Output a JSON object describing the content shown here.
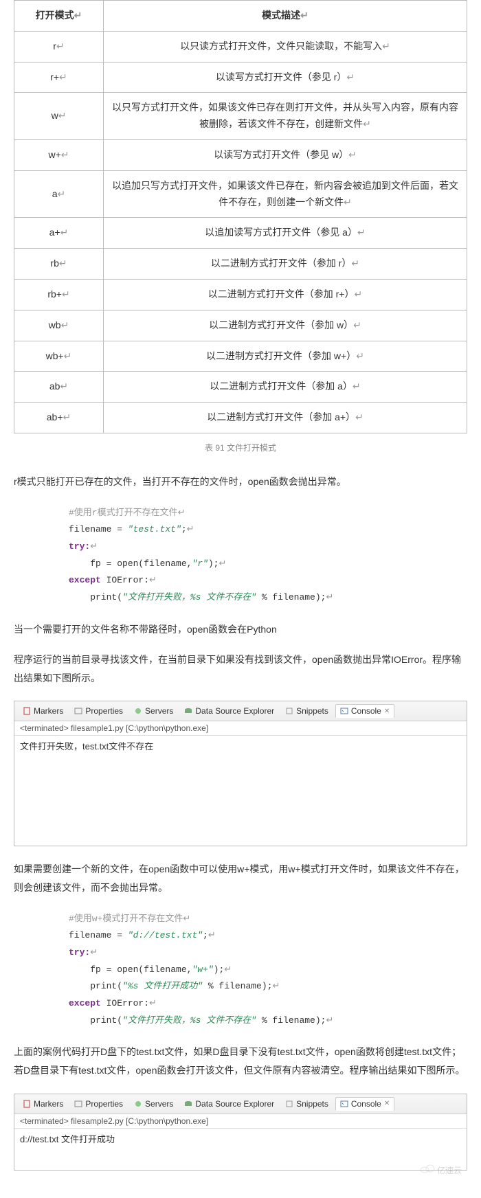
{
  "table": {
    "headers": [
      "打开模式",
      "模式描述"
    ],
    "rows": [
      {
        "mode": "r",
        "desc": "以只读方式打开文件，文件只能读取，不能写入"
      },
      {
        "mode": "r+",
        "desc": "以读写方式打开文件（参见 r）"
      },
      {
        "mode": "w",
        "desc": "以只写方式打开文件，如果该文件已存在则打开文件，并从头写入内容，原有内容被删除，若该文件不存在，创建新文件"
      },
      {
        "mode": "w+",
        "desc": "以读写方式打开文件（参见 w）"
      },
      {
        "mode": "a",
        "desc": "以追加只写方式打开文件，如果该文件已存在，新内容会被追加到文件后面，若文件不存在，则创建一个新文件"
      },
      {
        "mode": "a+",
        "desc": "以追加读写方式打开文件（参见 a）"
      },
      {
        "mode": "rb",
        "desc": "以二进制方式打开文件（参加 r）"
      },
      {
        "mode": "rb+",
        "desc": "以二进制方式打开文件（参加 r+）"
      },
      {
        "mode": "wb",
        "desc": "以二进制方式打开文件（参加 w）"
      },
      {
        "mode": "wb+",
        "desc": "以二进制方式打开文件（参加 w+）"
      },
      {
        "mode": "ab",
        "desc": "以二进制方式打开文件（参加 a）"
      },
      {
        "mode": "ab+",
        "desc": "以二进制方式打开文件（参加 a+）"
      }
    ]
  },
  "caption": "表 91 文件打开模式",
  "para1": "r模式只能打开已存在的文件，当打开不存在的文件时，open函数会抛出异常。",
  "code1": {
    "c1": "#使用r模式打开不存在文件",
    "l1a": "filename = ",
    "l1b": "\"test.txt\"",
    "l1c": ";",
    "l2": "try:",
    "l3a": "    fp = open(filename,",
    "l3b": "\"r\"",
    "l3c": ");",
    "l4a": "except",
    "l4b": " IOError:",
    "l5a": "    print(",
    "l5b": "\"文件打开失败，%s 文件不存在\"",
    "l5c": " % filename);"
  },
  "para2": "当一个需要打开的文件名称不带路径时，open函数会在Python",
  "para3": "程序运行的当前目录寻找该文件，在当前目录下如果没有找到该文件，open函数抛出异常IOError。程序输出结果如下图所示。",
  "ide": {
    "tabs": {
      "markers": "Markers",
      "properties": "Properties",
      "servers": "Servers",
      "dse": "Data Source Explorer",
      "snippets": "Snippets",
      "console": "Console"
    },
    "close_label": "✕",
    "sub1": "<terminated> filesample1.py [C:\\python\\python.exe]",
    "body1": "文件打开失败，test.txt文件不存在",
    "sub2": "<terminated> filesample2.py [C:\\python\\python.exe]",
    "body2": "d://test.txt 文件打开成功"
  },
  "para4": "如果需要创建一个新的文件，在open函数中可以使用w+模式，用w+模式打开文件时，如果该文件不存在，则会创建该文件，而不会抛出异常。",
  "code2": {
    "c1": "#使用w+模式打开不存在文件",
    "l1a": "filename = ",
    "l1b": "\"d://test.txt\"",
    "l1c": ";",
    "l2": "try:",
    "l3a": "    fp = open(filename,",
    "l3b": "\"w+\"",
    "l3c": ");",
    "l4a": "    print(",
    "l4b": "\"%s 文件打开成功\"",
    "l4c": " % filename);",
    "l5a": "except",
    "l5b": " IOError:",
    "l6a": "    print(",
    "l6b": "\"文件打开失败，%s 文件不存在\"",
    "l6c": " % filename);"
  },
  "para5": "上面的案例代码打开D盘下的test.txt文件，如果D盘目录下没有test.txt文件，open函数将创建test.txt文件；若D盘目录下有test.txt文件，open函数会打开该文件，但文件原有内容被清空。程序输出结果如下图所示。",
  "watermark": "亿速云",
  "ret": "↵"
}
